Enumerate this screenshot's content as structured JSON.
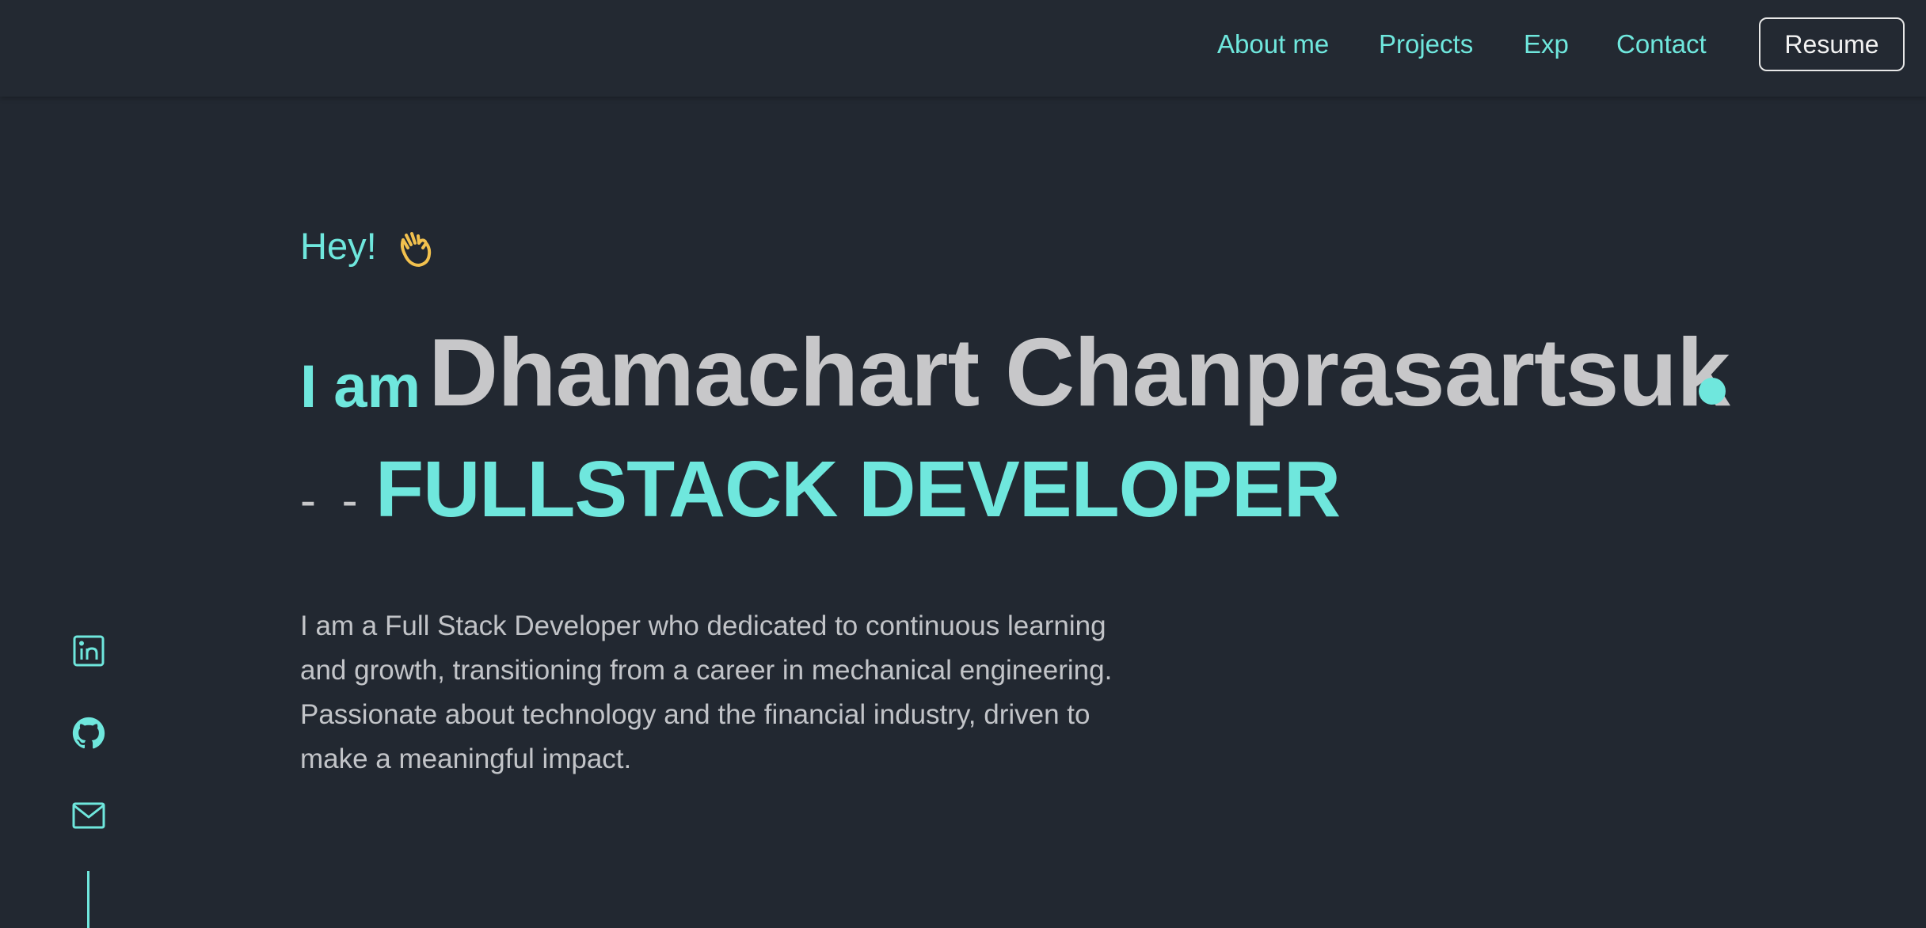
{
  "nav": {
    "links": [
      "About me",
      "Projects",
      "Exp",
      "Contact"
    ],
    "resume_label": "Resume"
  },
  "hero": {
    "greeting": "Hey!",
    "greeting_icon": "waving-hand-icon",
    "intro": "I am",
    "name": "Dhamachart Chanprasartsuk",
    "role_prefix": "- -",
    "role": "FULLSTACK DEVELOPER",
    "bio": "I am a Full Stack Developer who dedicated to continuous learning and growth, transitioning from a career in mechanical engineering. Passionate about technology and the financial industry, driven to make a meaningful impact."
  },
  "social": {
    "icons": [
      "linkedin-icon",
      "github-icon",
      "mail-icon"
    ]
  },
  "colors": {
    "background": "#222831",
    "accent": "#6fe7dd",
    "name": "#c7c7c9",
    "text": "#c2c4c8",
    "wave": "#f2c14e"
  }
}
